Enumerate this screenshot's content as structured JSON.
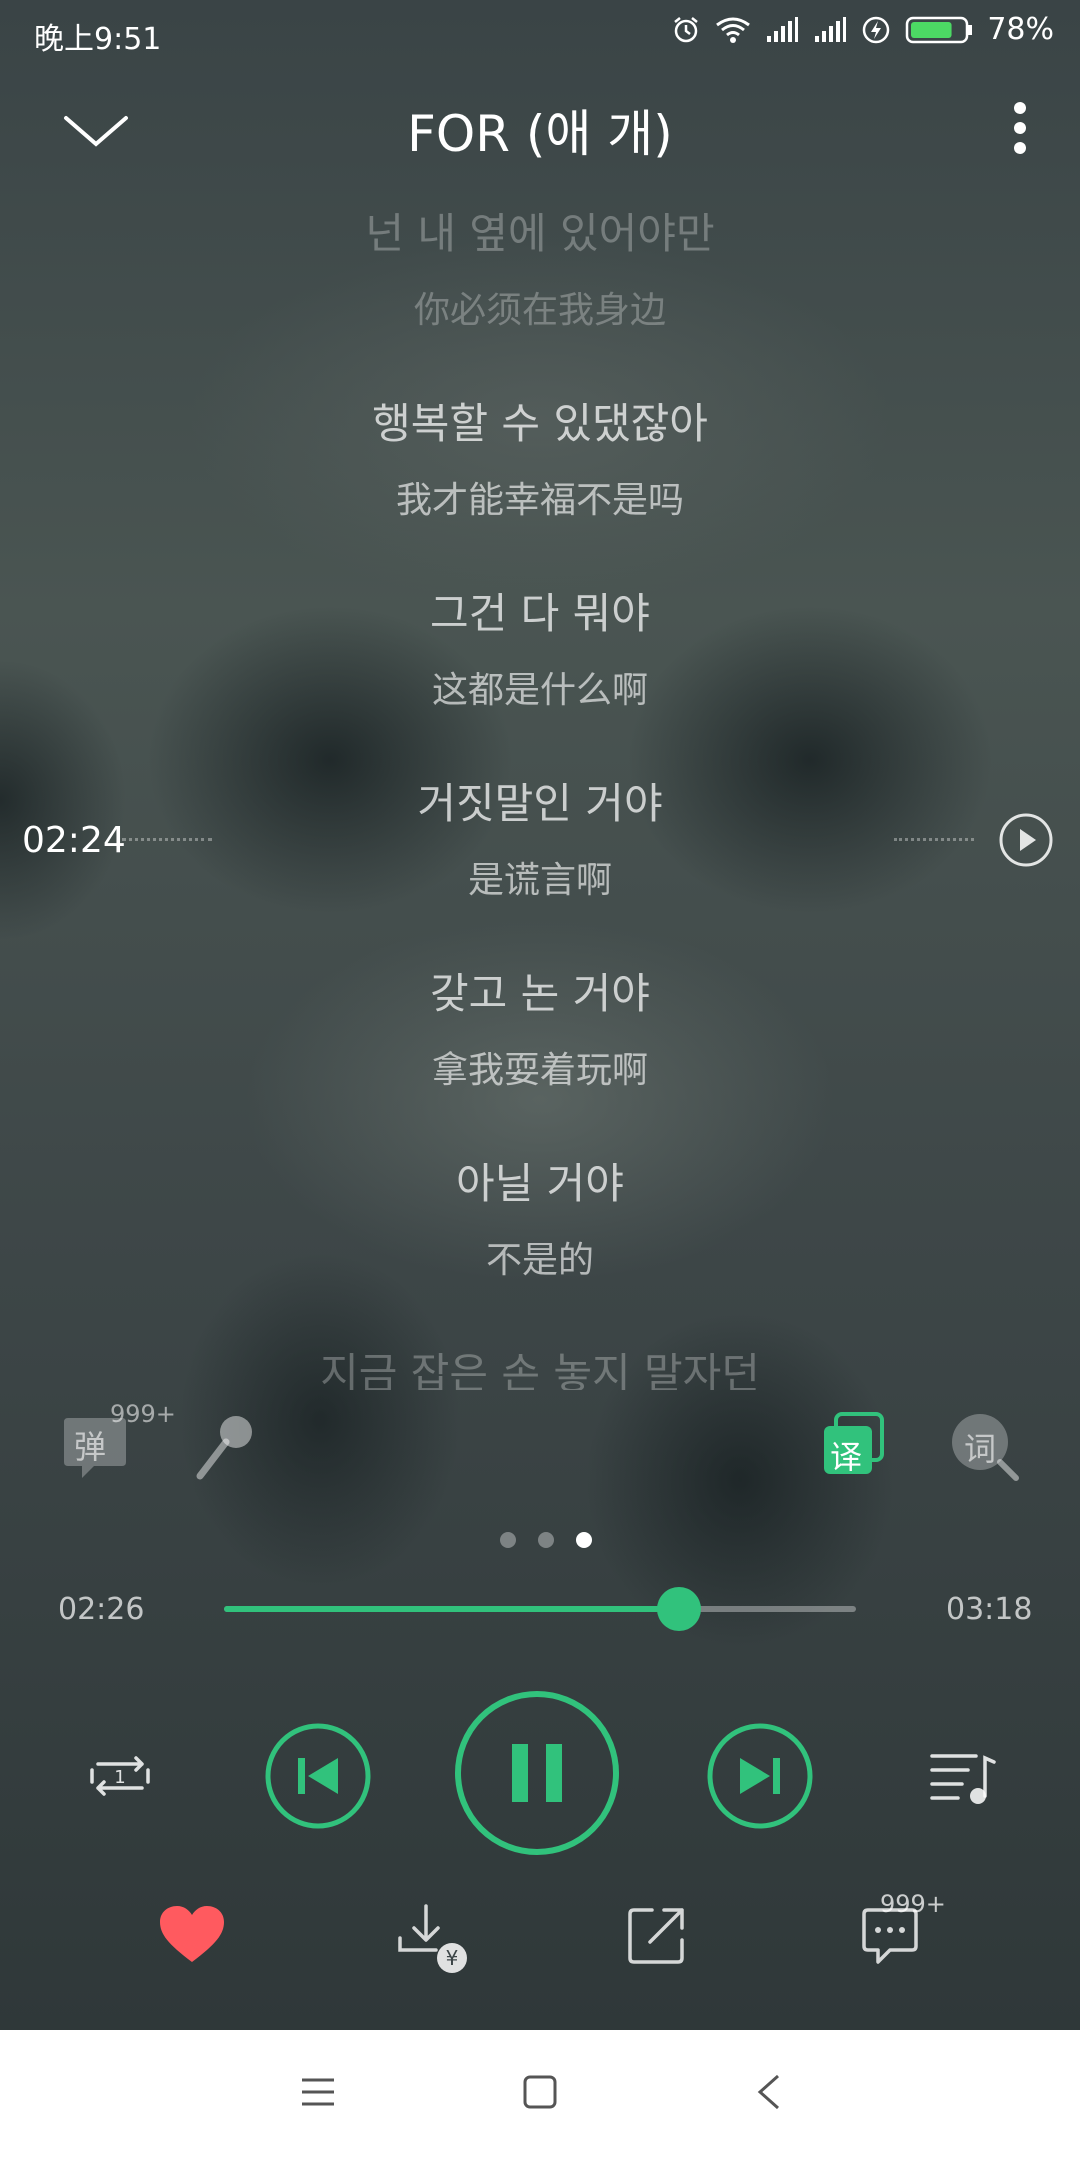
{
  "status_bar": {
    "time": "晚上9:51",
    "battery_percent": "78%",
    "battery_level": 0.78,
    "icons": [
      "alarm-icon",
      "wifi-icon",
      "signal-icon",
      "signal-icon",
      "charging-icon",
      "battery-icon"
    ]
  },
  "header": {
    "title": "FOR (애 개)",
    "collapse_icon": "chevron-down-icon",
    "more_icon": "more-vertical-icon"
  },
  "lyrics": [
    {
      "ko": "넌 내 옆에 있어야만",
      "zh": "你必须在我身边",
      "faded": true
    },
    {
      "ko": "행복할 수 있댔잖아",
      "zh": "我才能幸福不是吗",
      "faded": false
    },
    {
      "ko": "그건 다 뭐야",
      "zh": "这都是什么啊",
      "faded": false
    },
    {
      "ko": "거짓말인 거야",
      "zh": "是谎言啊",
      "faded": false
    },
    {
      "ko": "갖고 논 거야",
      "zh": "拿我耍着玩啊",
      "faded": false
    },
    {
      "ko": "아닐 거야",
      "zh": "不是的",
      "faded": false
    },
    {
      "ko": "지금 잡은 손 놓지 말자던",
      "zh": "",
      "faded": true
    }
  ],
  "scrub": {
    "time": "02:24",
    "play_icon": "play-circle-icon"
  },
  "tools": {
    "danmu_label": "弹",
    "danmu_badge": "999+",
    "mic_icon": "microphone-icon",
    "translate_label": "译",
    "wordsearch_label": "词"
  },
  "pager": {
    "count": 3,
    "active_index": 2
  },
  "progress": {
    "current": "02:26",
    "total": "03:18",
    "fraction": 0.72
  },
  "controls": {
    "repeat_icon": "repeat-one-icon",
    "prev_icon": "skip-previous-icon",
    "play_pause_icon": "pause-icon",
    "next_icon": "skip-next-icon",
    "playlist_icon": "playlist-icon",
    "accent_color": "#31c27c"
  },
  "actions": {
    "like_icon": "heart-icon",
    "like_color": "#ff5a5f",
    "download_icon": "download-paid-icon",
    "share_icon": "share-icon",
    "comment_icon": "comment-icon",
    "comment_badge": "999+"
  },
  "nav": {
    "menu_icon": "menu-icon",
    "home_icon": "home-icon",
    "back_icon": "back-icon"
  }
}
